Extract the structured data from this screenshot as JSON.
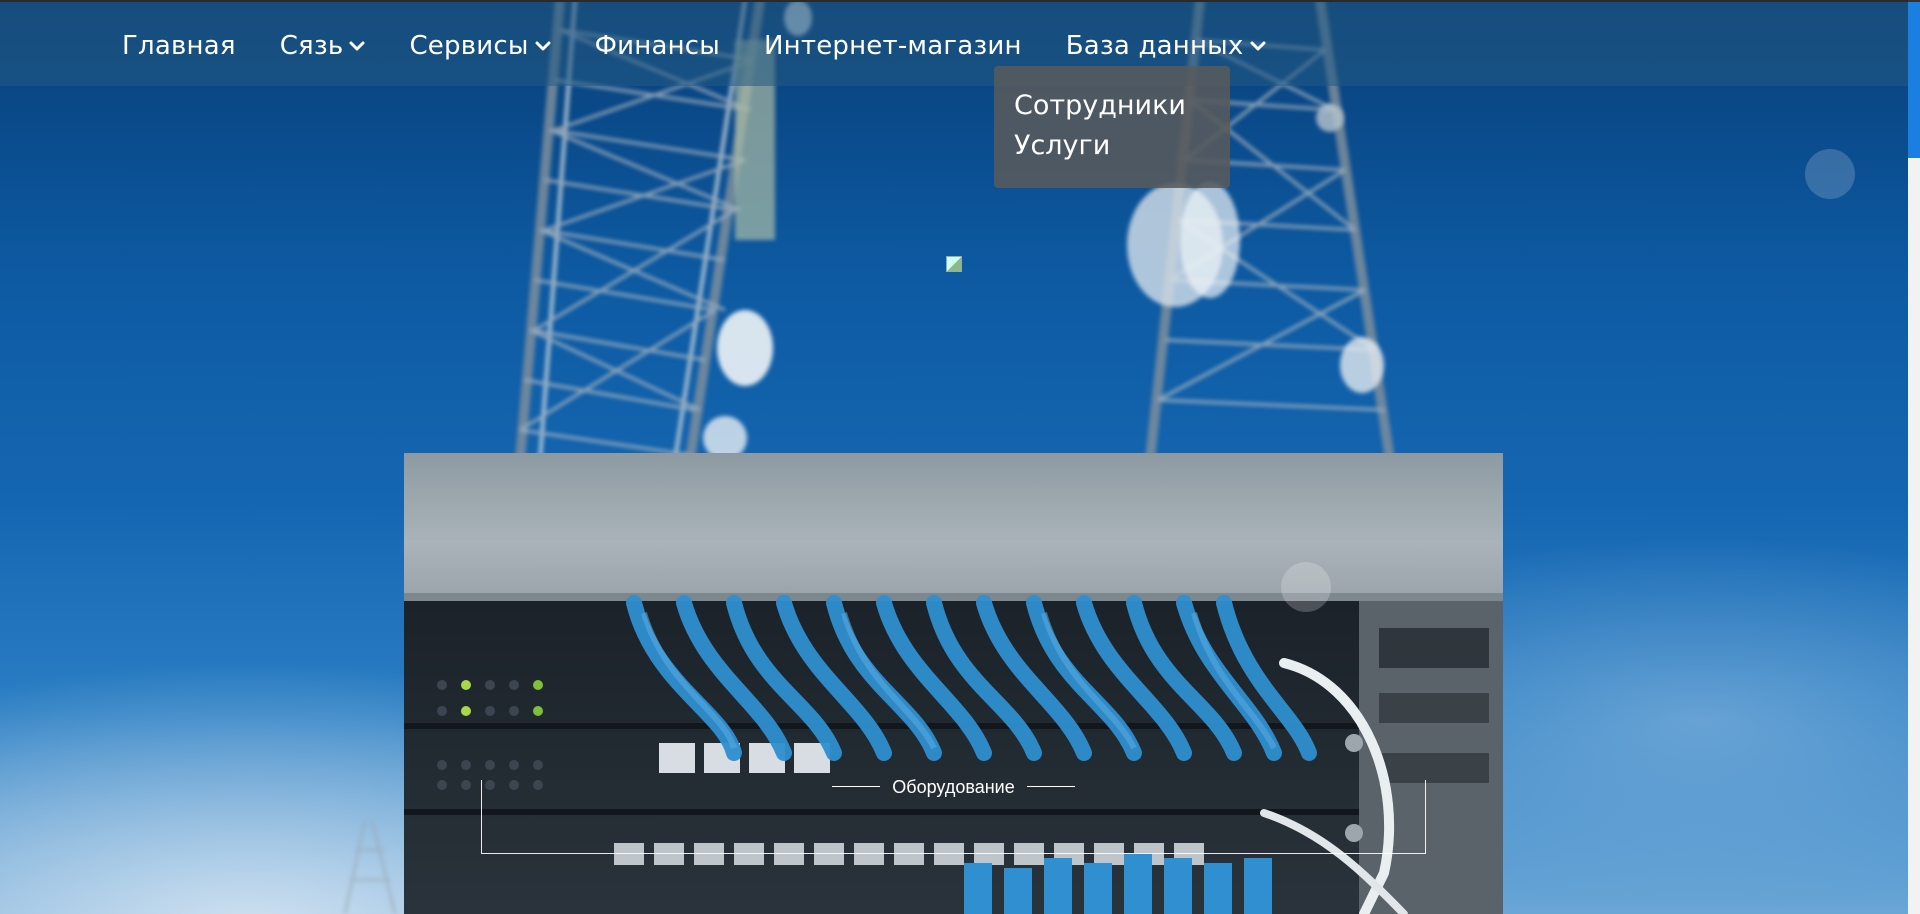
{
  "nav": {
    "items": [
      {
        "label": "Главная",
        "has_dropdown": false
      },
      {
        "label": "Сязь",
        "has_dropdown": true
      },
      {
        "label": "Сервисы",
        "has_dropdown": true
      },
      {
        "label": "Финансы",
        "has_dropdown": false
      },
      {
        "label": "Интернет-магазин",
        "has_dropdown": false
      },
      {
        "label": "База данных",
        "has_dropdown": true
      }
    ]
  },
  "dropdown": {
    "items": [
      {
        "label": "Сотрудники"
      },
      {
        "label": "Услуги"
      }
    ]
  },
  "feature": {
    "caption": "Оборудование"
  },
  "icons": {
    "dropdown_indicator": "chevron-down-icon",
    "broken_image": "broken-image-icon"
  },
  "colors": {
    "navbar_bg": "#235a82",
    "dropdown_bg": "#58595c",
    "scrollbar_thumb": "#1a7fe0",
    "text": "#ffffff",
    "cable_blue": "#2f8fd0"
  }
}
